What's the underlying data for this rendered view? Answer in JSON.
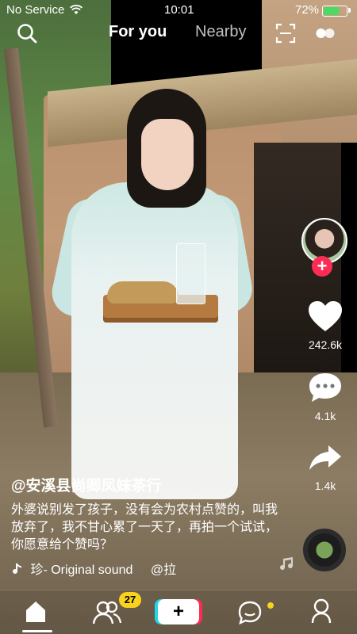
{
  "status_bar": {
    "carrier": "No Service",
    "time": "10:01",
    "battery": "72%",
    "battery_level": 0.72
  },
  "top_nav": {
    "tab_for_you": "For you",
    "tab_nearby": "Nearby",
    "icons": [
      "search-icon",
      "scan-icon",
      "live-icon"
    ]
  },
  "video": {
    "username": "@安溪县尚卿凤妹茶行",
    "description": "外婆说别发了孩子，没有会为农村点赞的，叫我放弃了，我不甘心累了一天了，再拍一个试试，你愿意给个赞吗？",
    "sound_label": "珍- Original sound",
    "sound_extra": "@拉"
  },
  "actions": {
    "likes": "242.6k",
    "comments": "4.1k",
    "shares": "1.4k"
  },
  "bottom_nav": {
    "badge_count": "27",
    "create_symbol": "+"
  },
  "colors": {
    "accent": "#fe2c55",
    "badge": "#f9d21d",
    "cyan": "#20d5ec"
  }
}
